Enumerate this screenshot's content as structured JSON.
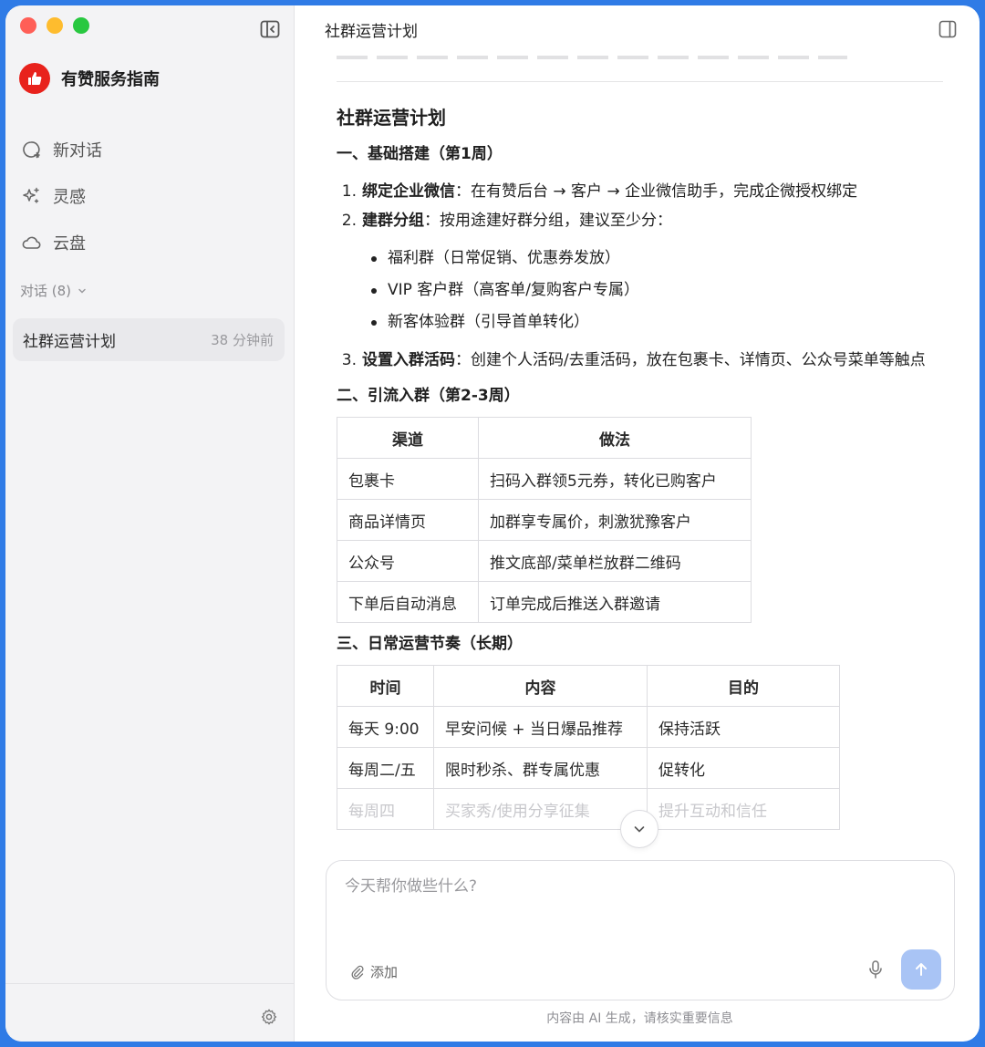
{
  "app": {
    "name": "有赞服务指南",
    "accent": "#e8221c"
  },
  "sidebar": {
    "items": [
      {
        "label": "新对话",
        "icon": "new-chat-icon"
      },
      {
        "label": "灵感",
        "icon": "sparkle-icon"
      },
      {
        "label": "云盘",
        "icon": "cloud-icon"
      }
    ],
    "section_label": "对话 (8)",
    "conversations": [
      {
        "title": "社群运营计划",
        "time": "38 分钟前"
      }
    ]
  },
  "header": {
    "title": "社群运营计划"
  },
  "document": {
    "title": "社群运营计划",
    "section1": {
      "heading": "一、基础搭建（第1周）",
      "items": [
        {
          "num": "1.",
          "bold": "绑定企业微信",
          "text": "：在有赞后台 → 客户 → 企业微信助手，完成企微授权绑定"
        },
        {
          "num": "2.",
          "bold": "建群分组",
          "text": "：按用途建好群分组，建议至少分："
        },
        {
          "num": "3.",
          "bold": "设置入群活码",
          "text": "：创建个人活码/去重活码，放在包裹卡、详情页、公众号菜单等触点"
        }
      ],
      "bullets": [
        "福利群（日常促销、优惠券发放）",
        "VIP 客户群（高客单/复购客户专属）",
        "新客体验群（引导首单转化）"
      ]
    },
    "section2": {
      "heading": "二、引流入群（第2-3周）",
      "columns": [
        "渠道",
        "做法"
      ],
      "rows": [
        [
          "包裹卡",
          "扫码入群领5元券，转化已购客户"
        ],
        [
          "商品详情页",
          "加群享专属价，刺激犹豫客户"
        ],
        [
          "公众号",
          "推文底部/菜单栏放群二维码"
        ],
        [
          "下单后自动消息",
          "订单完成后推送入群邀请"
        ]
      ]
    },
    "section3": {
      "heading": "三、日常运营节奏（长期）",
      "columns": [
        "时间",
        "内容",
        "目的"
      ],
      "rows": [
        [
          "每天 9:00",
          "早安问候 + 当日爆品推荐",
          "保持活跃"
        ],
        [
          "每周二/五",
          "限时秒杀、群专属优惠",
          "促转化"
        ],
        [
          "每周四",
          "买家秀/使用分享征集",
          "提升互动和信任"
        ]
      ]
    }
  },
  "composer": {
    "placeholder": "今天帮你做些什么?",
    "attach_label": "添加",
    "send_color": "#a9c4f5"
  },
  "footer": {
    "disclaimer": "内容由 AI 生成，请核实重要信息"
  }
}
